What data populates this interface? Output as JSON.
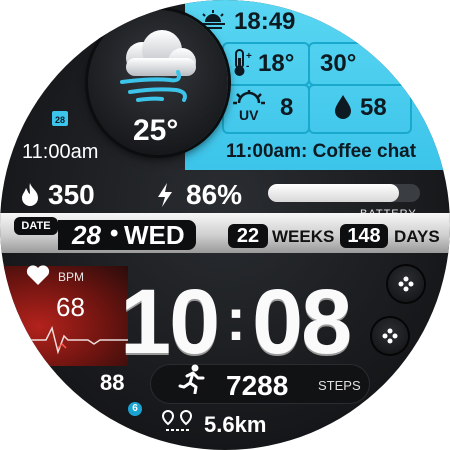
{
  "header": {
    "sunset_time": "18:49"
  },
  "weather": {
    "temperature": "25°",
    "thermometer_temp": "18°",
    "max_temp": "30°",
    "uv_index": "8",
    "humidity": "58"
  },
  "event": {
    "text": "11:00am: Coffee chat",
    "calendar_day": "28",
    "time": "11:00am"
  },
  "stats": {
    "calories": "350",
    "battery_percent": "86%",
    "battery_level": 0.86,
    "battery_label": "BATTERY"
  },
  "date": {
    "date_label": "DATE",
    "day_number": "28",
    "separator": "•",
    "weekday": "WED",
    "weeks_value": "22",
    "weeks_label": "WEEKS",
    "days_value": "148",
    "days_label": "DAYS"
  },
  "heart": {
    "bpm_label": "BPM",
    "bpm_value": "68"
  },
  "clock": {
    "hours": "10",
    "colon": ":",
    "minutes": "08"
  },
  "activity": {
    "value_88": "88",
    "badge_6": "6",
    "steps": "7288",
    "steps_label": "STEPS",
    "distance": "5.6km"
  },
  "colors": {
    "accent_cyan": "#3cc4ea",
    "heart_red": "#b3221c",
    "dark_bg": "#1a1c1f"
  }
}
